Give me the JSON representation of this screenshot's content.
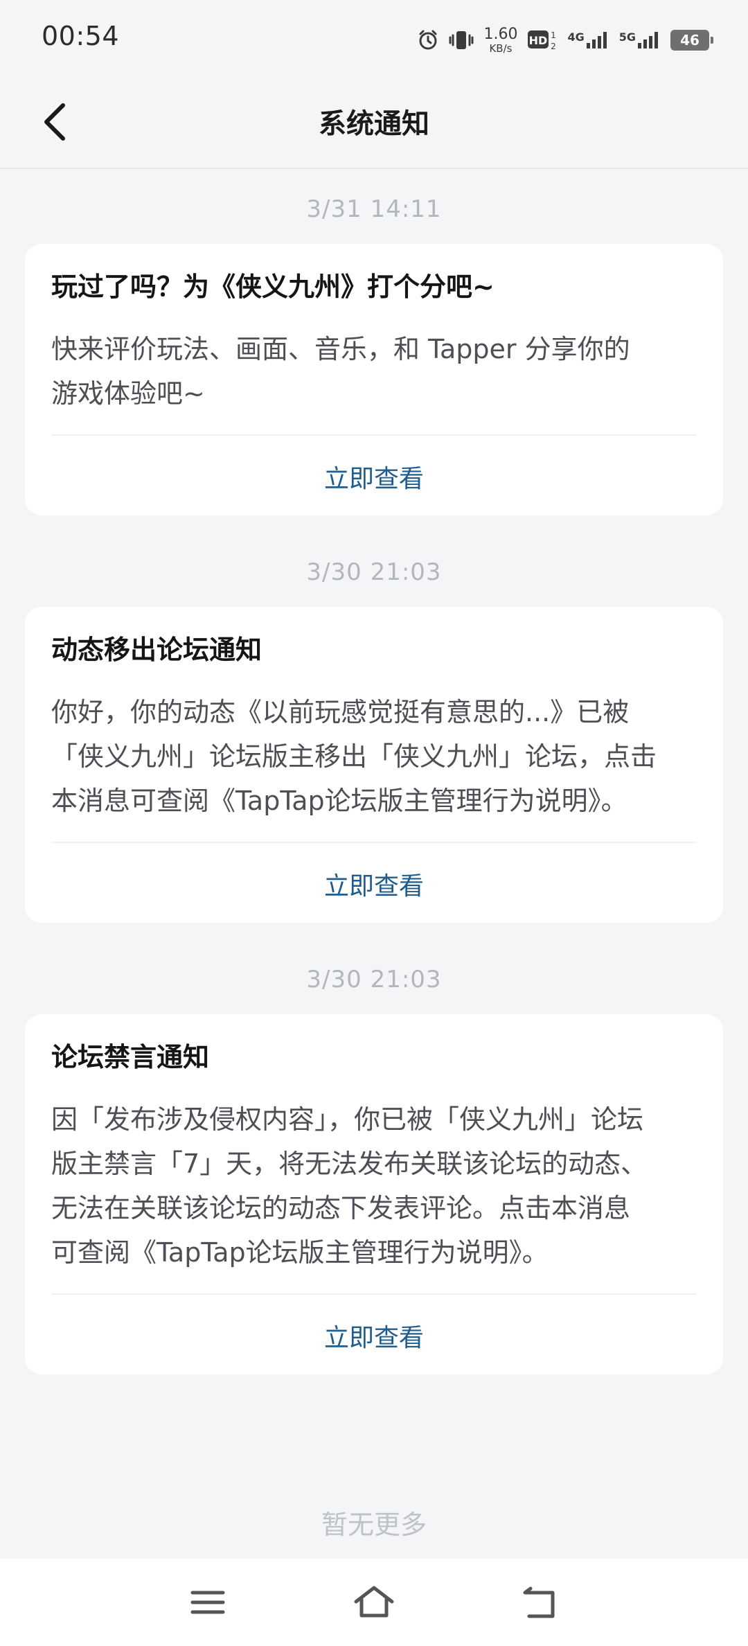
{
  "status_bar": {
    "time": "00:54",
    "net_speed_value": "1.60",
    "net_speed_unit": "KB/s",
    "hd_label": "HD",
    "sim1_label": "4G",
    "sim2_label": "5G",
    "battery": "46"
  },
  "header": {
    "title": "系统通知"
  },
  "messages": [
    {
      "timestamp": "3/31  14:11",
      "title": "玩过了吗？为《侠义九州》打个分吧~",
      "body_lines": [
        "快来评价玩法、画面、音乐，和 Tapper 分享你的",
        "游戏体验吧~"
      ],
      "action": "立即查看"
    },
    {
      "timestamp": "3/30  21:03",
      "title": "动态移出论坛通知",
      "body_lines": [
        "你好，你的动态《以前玩感觉挺有意思的...》已被",
        "「侠义九州」论坛版主移出「侠义九州」论坛，点击",
        "本消息可查阅《TapTap论坛版主管理行为说明》。"
      ],
      "action": "立即查看"
    },
    {
      "timestamp": "3/30  21:03",
      "title": "论坛禁言通知",
      "body_lines": [
        "因「发布涉及侵权内容」，你已被「侠义九州」论坛",
        "版主禁言「7」天，将无法发布关联该论坛的动态、",
        "无法在关联该论坛的动态下发表评论。点击本消息",
        "可查阅《TapTap论坛版主管理行为说明》。"
      ],
      "action": "立即查看"
    }
  ],
  "footer": {
    "no_more": "暂无更多"
  },
  "icons": {
    "back": "chevron-left-icon",
    "menu": "menu-icon",
    "home": "home-icon",
    "return": "return-icon"
  },
  "colors": {
    "background": "#f4f5f7",
    "card": "#ffffff",
    "link": "#1f5d8f",
    "timestamp": "#b3b6bc"
  }
}
